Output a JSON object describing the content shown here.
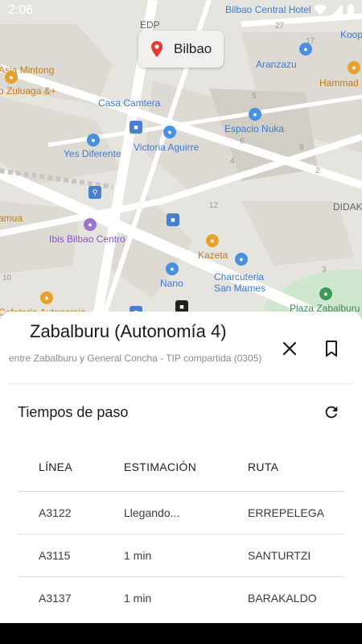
{
  "status_bar": {
    "time": "2:06"
  },
  "map": {
    "city_chip": "Bilbao",
    "labels": {
      "edp": "EDP",
      "bilbao_central": "Bilbao Central Hotel",
      "koop": "Koop",
      "aranzazu": "Aranzazu",
      "hammad": "Hammad",
      "mintong": "Asia Mintong",
      "zuluaga": "o Zuluaga &+",
      "casa_camtera": "Casa Camtera",
      "espacio_nuka": "Espacio Nuka",
      "yes_diferente": "Yes Diferente",
      "victoria_aguirre": "Victoria Aguirre",
      "didak": "DIDAK",
      "camua": "amua",
      "ibis": "Ibis Bilbao Centro",
      "kazeta": "Kazeta",
      "nano": "Nano",
      "charcuteria": "Charcuteria\nSan Mames",
      "plaza_zabalburu": "Plaza Zabalburu",
      "cafeteria": "Cafeteria Autonomia",
      "house_numbers": [
        "27",
        "17",
        "5",
        "6",
        "4",
        "8",
        "2",
        "3",
        "10",
        "12"
      ]
    }
  },
  "sheet": {
    "title": "Zabalburu (Autonomía 4)",
    "subtitle": "entre Zabalburu y General Concha - TIP compartida (0305)",
    "section_title": "Tiempos de paso",
    "columns": [
      "LÍNEA",
      "ESTIMACIÓN",
      "RUTA"
    ],
    "rows": [
      {
        "linea": "A3122",
        "estimacion": "Llegando...",
        "ruta": "ERREPELEGA"
      },
      {
        "linea": "A3115",
        "estimacion": "1 min",
        "ruta": "SANTURTZI"
      },
      {
        "linea": "A3137",
        "estimacion": "1 min",
        "ruta": "BARAKALDO"
      }
    ]
  },
  "colors": {
    "map_bg": "#e8e6e1",
    "block": "#dcd9d3",
    "road": "#ffffff",
    "park": "#cfe8cf",
    "poi_blue": "#3a7bd5",
    "poi_orange": "#c77a12",
    "pin_red": "#e53935"
  }
}
